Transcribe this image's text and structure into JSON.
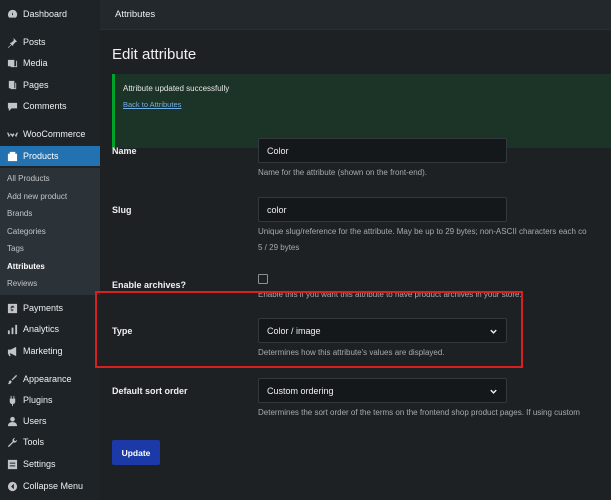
{
  "sidebar": {
    "items": [
      {
        "label": "Dashboard",
        "icon": "dashboard-icon"
      },
      {
        "label": "Posts",
        "icon": "pin-icon"
      },
      {
        "label": "Media",
        "icon": "media-icon"
      },
      {
        "label": "Pages",
        "icon": "pages-icon"
      },
      {
        "label": "Comments",
        "icon": "comment-icon"
      },
      {
        "label": "WooCommerce",
        "icon": "woocommerce-icon"
      },
      {
        "label": "Products",
        "icon": "products-icon"
      },
      {
        "label": "Payments",
        "icon": "payments-icon"
      },
      {
        "label": "Analytics",
        "icon": "analytics-icon"
      },
      {
        "label": "Marketing",
        "icon": "megaphone-icon"
      },
      {
        "label": "Appearance",
        "icon": "brush-icon"
      },
      {
        "label": "Plugins",
        "icon": "plug-icon"
      },
      {
        "label": "Users",
        "icon": "user-icon"
      },
      {
        "label": "Tools",
        "icon": "wrench-icon"
      },
      {
        "label": "Settings",
        "icon": "settings-icon"
      },
      {
        "label": "Collapse Menu",
        "icon": "collapse-icon"
      }
    ],
    "submenu": [
      "All Products",
      "Add new product",
      "Brands",
      "Categories",
      "Tags",
      "Attributes",
      "Reviews"
    ]
  },
  "header": {
    "title": "Attributes"
  },
  "page": {
    "title": "Edit attribute",
    "notice": "Attribute updated successfully",
    "back_link": "Back to Attributes",
    "name_label": "Name",
    "name_value": "Color",
    "name_help": "Name for the attribute (shown on the front-end).",
    "slug_label": "Slug",
    "slug_value": "color",
    "slug_help": "Unique slug/reference for the attribute. May be up to 29 bytes; non-ASCII characters each co",
    "slug_count": "5 / 29 bytes",
    "archives_label": "Enable archives?",
    "archives_help": "Enable this if you want this attribute to have product archives in your store.",
    "type_label": "Type",
    "type_value": "Color / image",
    "type_help": "Determines how this attribute's values are displayed.",
    "sort_label": "Default sort order",
    "sort_value": "Custom ordering",
    "sort_help": "Determines the sort order of the terms on the frontend shop product pages. If using custom",
    "update_label": "Update"
  },
  "colors": {
    "accent": "#2271b1",
    "highlight": "#d92020",
    "notice_border": "#00a32a",
    "button": "#1b3aa8"
  }
}
